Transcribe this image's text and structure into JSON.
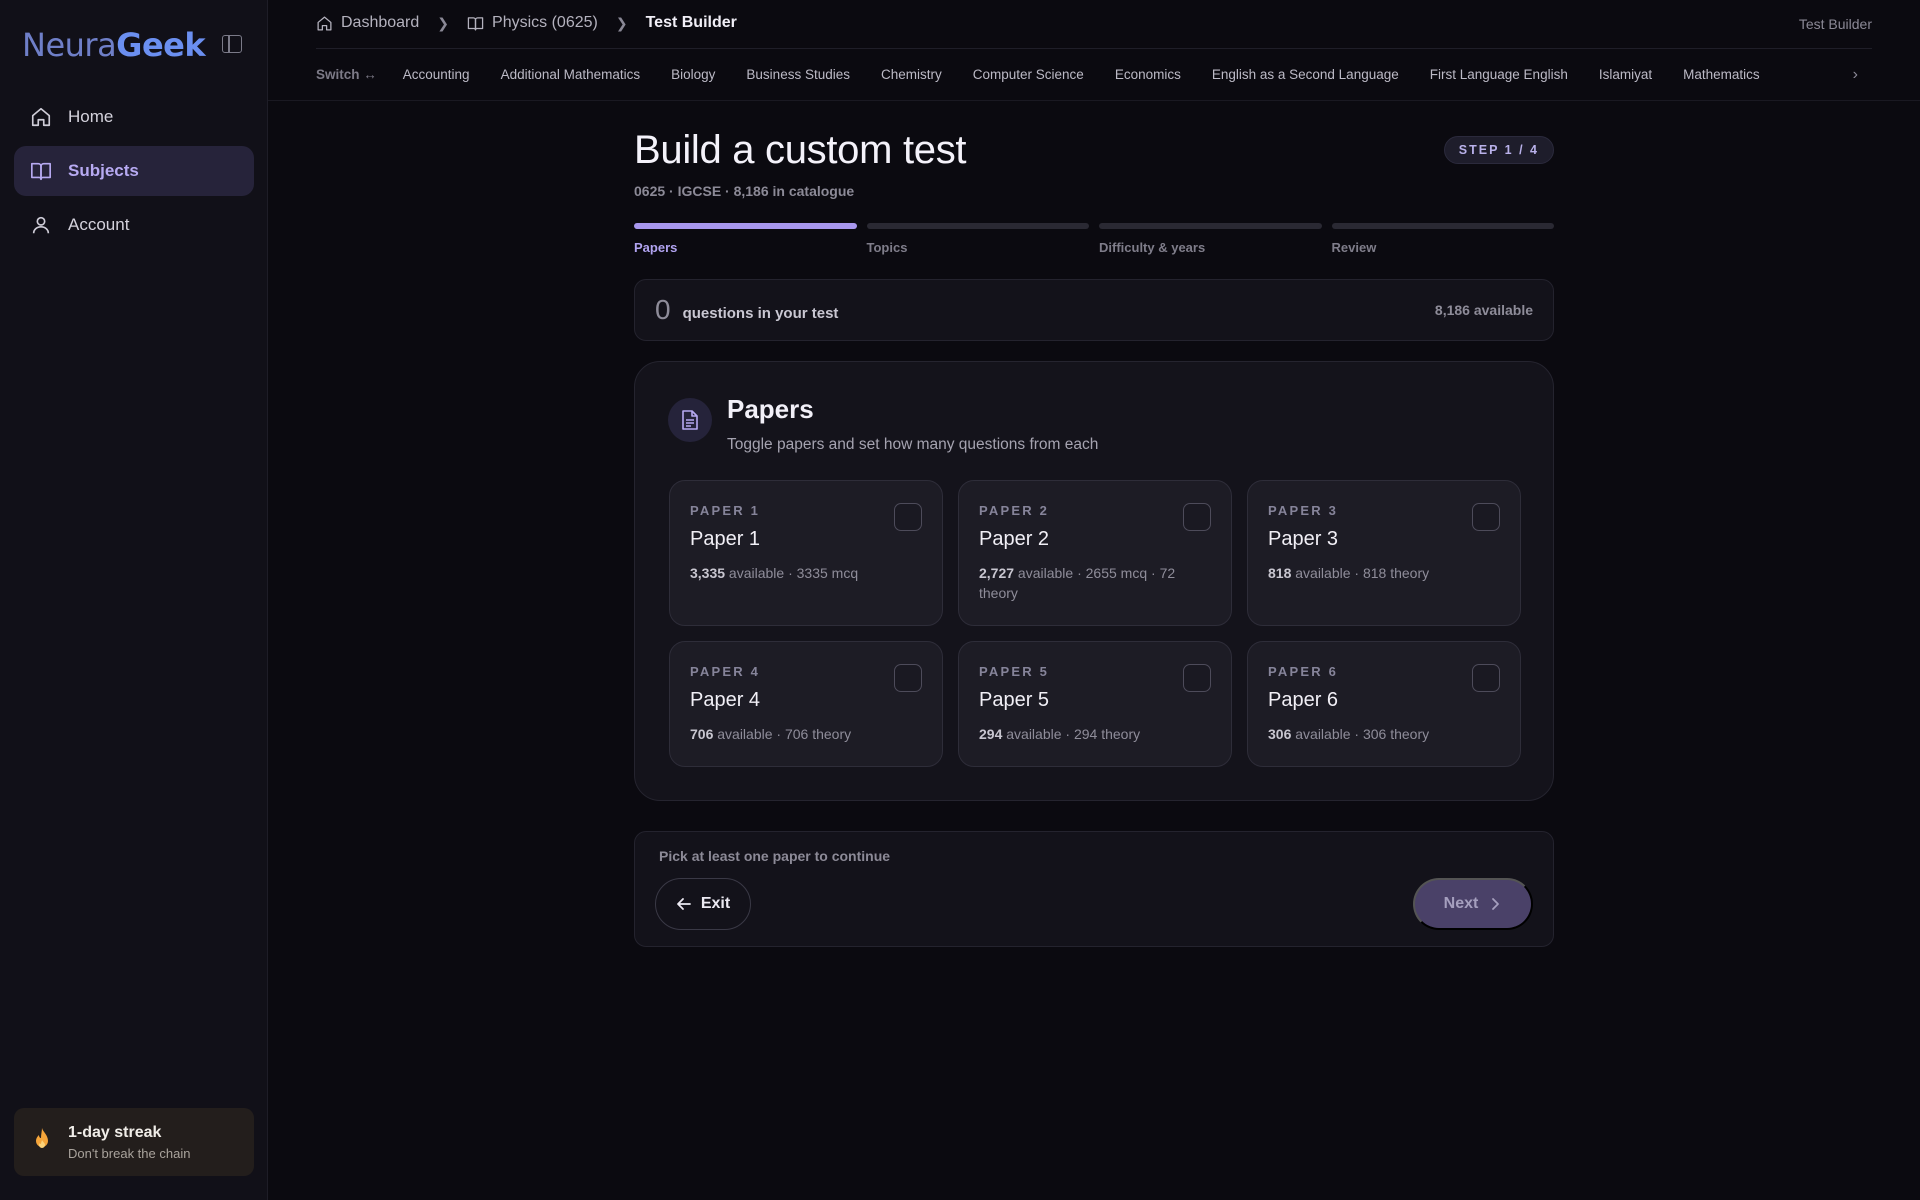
{
  "app": {
    "logo_part1": "Neura",
    "logo_part2": "Geek"
  },
  "sidebar": {
    "items": [
      {
        "label": "Home",
        "icon": "home-icon"
      },
      {
        "label": "Subjects",
        "icon": "book-icon",
        "active": true
      },
      {
        "label": "Account",
        "icon": "user-icon"
      }
    ],
    "streak": {
      "title": "1-day streak",
      "subtitle": "Don't break the chain"
    }
  },
  "breadcrumb": {
    "items": [
      "Dashboard",
      "Physics (0625)",
      "Test Builder"
    ],
    "right_label": "Test Builder"
  },
  "subject_bar": {
    "switch_label": "Switch ↔",
    "subjects": [
      "Accounting",
      "Additional Mathematics",
      "Biology",
      "Business Studies",
      "Chemistry",
      "Computer Science",
      "Economics",
      "English as a Second Language",
      "First Language English",
      "Islamiyat",
      "Mathematics"
    ]
  },
  "main": {
    "title": "Build a custom test",
    "subtitle": "0625 · IGCSE · 8,186 in catalogue",
    "step_badge": "STEP 1 / 4",
    "steps": [
      "Papers",
      "Topics",
      "Difficulty & years",
      "Review"
    ],
    "active_step": 0,
    "count": {
      "value": "0",
      "label": "questions in your test",
      "available": "8,186 available"
    },
    "papers_section": {
      "title": "Papers",
      "subtitle": "Toggle papers and set how many questions from each",
      "papers": [
        {
          "kicker": "PAPER 1",
          "name": "Paper 1",
          "count": "3,335",
          "detail": " available · 3335 mcq"
        },
        {
          "kicker": "PAPER 2",
          "name": "Paper 2",
          "count": "2,727",
          "detail": " available · 2655 mcq · 72 theory"
        },
        {
          "kicker": "PAPER 3",
          "name": "Paper 3",
          "count": "818",
          "detail": " available · 818 theory"
        },
        {
          "kicker": "PAPER 4",
          "name": "Paper 4",
          "count": "706",
          "detail": " available · 706 theory"
        },
        {
          "kicker": "PAPER 5",
          "name": "Paper 5",
          "count": "294",
          "detail": " available · 294 theory"
        },
        {
          "kicker": "PAPER 6",
          "name": "Paper 6",
          "count": "306",
          "detail": " available · 306 theory"
        }
      ]
    },
    "footer": {
      "hint": "Pick at least one paper to continue",
      "exit_label": "Exit",
      "next_label": "Next"
    }
  },
  "colors": {
    "accent": "#a897ee",
    "background": "#0b0a10",
    "streak_flame": "#f5a53a"
  }
}
